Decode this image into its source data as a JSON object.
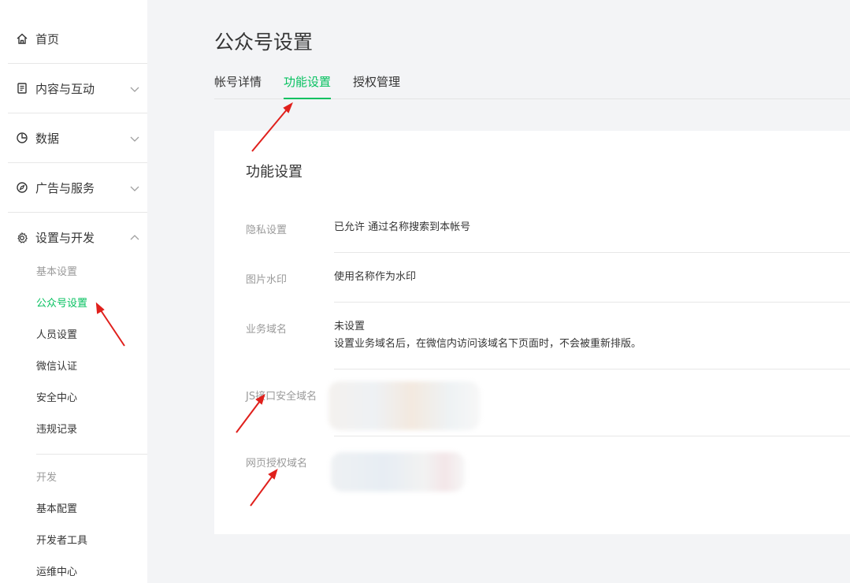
{
  "sidebar": {
    "home": "首页",
    "content": "内容与互动",
    "data": "数据",
    "ads": "广告与服务",
    "settings": "设置与开发",
    "sub": {
      "basic_header": "基本设置",
      "account": "公众号设置",
      "staff": "人员设置",
      "verify": "微信认证",
      "security": "安全中心",
      "violations": "违规记录",
      "dev_header": "开发",
      "basic_config": "基本配置",
      "dev_tools": "开发者工具",
      "ops": "运维中心"
    }
  },
  "page": {
    "title": "公众号设置",
    "tabs": [
      "帐号详情",
      "功能设置",
      "授权管理"
    ]
  },
  "card": {
    "title": "功能设置",
    "rows": [
      {
        "label": "隐私设置",
        "value": "已允许 通过名称搜索到本帐号"
      },
      {
        "label": "图片水印",
        "value": "使用名称作为水印"
      },
      {
        "label": "业务域名",
        "value": "未设置",
        "desc": "设置业务域名后，在微信内访问该域名下页面时，不会被重新排版。"
      },
      {
        "label": "JS接口安全域名",
        "value": ""
      },
      {
        "label": "网页授权域名",
        "value": ""
      }
    ]
  },
  "colors": {
    "accent": "#07c160",
    "annotation": "#e0201c"
  }
}
